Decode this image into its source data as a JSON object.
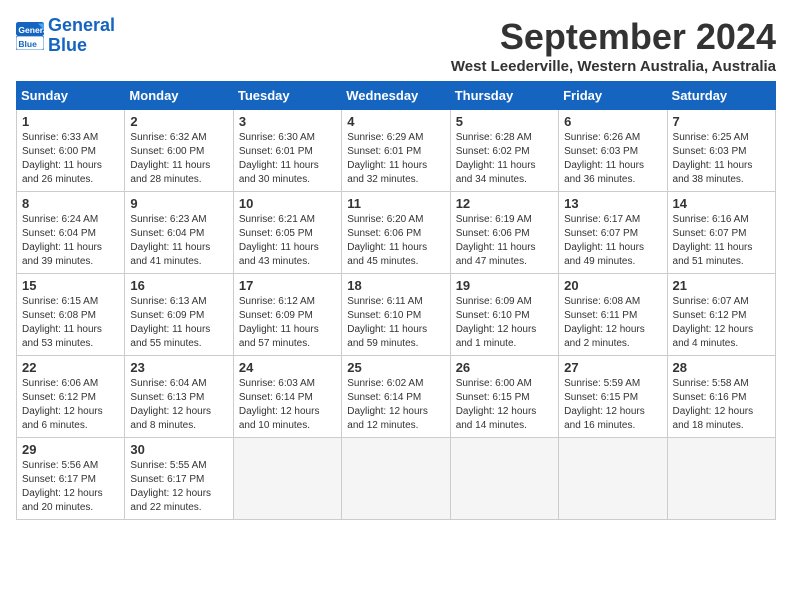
{
  "logo": {
    "line1": "General",
    "line2": "Blue"
  },
  "title": "September 2024",
  "location": "West Leederville, Western Australia, Australia",
  "weekdays": [
    "Sunday",
    "Monday",
    "Tuesday",
    "Wednesday",
    "Thursday",
    "Friday",
    "Saturday"
  ],
  "weeks": [
    [
      {
        "day": "1",
        "lines": [
          "Sunrise: 6:33 AM",
          "Sunset: 6:00 PM",
          "Daylight: 11 hours",
          "and 26 minutes."
        ]
      },
      {
        "day": "2",
        "lines": [
          "Sunrise: 6:32 AM",
          "Sunset: 6:00 PM",
          "Daylight: 11 hours",
          "and 28 minutes."
        ]
      },
      {
        "day": "3",
        "lines": [
          "Sunrise: 6:30 AM",
          "Sunset: 6:01 PM",
          "Daylight: 11 hours",
          "and 30 minutes."
        ]
      },
      {
        "day": "4",
        "lines": [
          "Sunrise: 6:29 AM",
          "Sunset: 6:01 PM",
          "Daylight: 11 hours",
          "and 32 minutes."
        ]
      },
      {
        "day": "5",
        "lines": [
          "Sunrise: 6:28 AM",
          "Sunset: 6:02 PM",
          "Daylight: 11 hours",
          "and 34 minutes."
        ]
      },
      {
        "day": "6",
        "lines": [
          "Sunrise: 6:26 AM",
          "Sunset: 6:03 PM",
          "Daylight: 11 hours",
          "and 36 minutes."
        ]
      },
      {
        "day": "7",
        "lines": [
          "Sunrise: 6:25 AM",
          "Sunset: 6:03 PM",
          "Daylight: 11 hours",
          "and 38 minutes."
        ]
      }
    ],
    [
      {
        "day": "8",
        "lines": [
          "Sunrise: 6:24 AM",
          "Sunset: 6:04 PM",
          "Daylight: 11 hours",
          "and 39 minutes."
        ]
      },
      {
        "day": "9",
        "lines": [
          "Sunrise: 6:23 AM",
          "Sunset: 6:04 PM",
          "Daylight: 11 hours",
          "and 41 minutes."
        ]
      },
      {
        "day": "10",
        "lines": [
          "Sunrise: 6:21 AM",
          "Sunset: 6:05 PM",
          "Daylight: 11 hours",
          "and 43 minutes."
        ]
      },
      {
        "day": "11",
        "lines": [
          "Sunrise: 6:20 AM",
          "Sunset: 6:06 PM",
          "Daylight: 11 hours",
          "and 45 minutes."
        ]
      },
      {
        "day": "12",
        "lines": [
          "Sunrise: 6:19 AM",
          "Sunset: 6:06 PM",
          "Daylight: 11 hours",
          "and 47 minutes."
        ]
      },
      {
        "day": "13",
        "lines": [
          "Sunrise: 6:17 AM",
          "Sunset: 6:07 PM",
          "Daylight: 11 hours",
          "and 49 minutes."
        ]
      },
      {
        "day": "14",
        "lines": [
          "Sunrise: 6:16 AM",
          "Sunset: 6:07 PM",
          "Daylight: 11 hours",
          "and 51 minutes."
        ]
      }
    ],
    [
      {
        "day": "15",
        "lines": [
          "Sunrise: 6:15 AM",
          "Sunset: 6:08 PM",
          "Daylight: 11 hours",
          "and 53 minutes."
        ]
      },
      {
        "day": "16",
        "lines": [
          "Sunrise: 6:13 AM",
          "Sunset: 6:09 PM",
          "Daylight: 11 hours",
          "and 55 minutes."
        ]
      },
      {
        "day": "17",
        "lines": [
          "Sunrise: 6:12 AM",
          "Sunset: 6:09 PM",
          "Daylight: 11 hours",
          "and 57 minutes."
        ]
      },
      {
        "day": "18",
        "lines": [
          "Sunrise: 6:11 AM",
          "Sunset: 6:10 PM",
          "Daylight: 11 hours",
          "and 59 minutes."
        ]
      },
      {
        "day": "19",
        "lines": [
          "Sunrise: 6:09 AM",
          "Sunset: 6:10 PM",
          "Daylight: 12 hours",
          "and 1 minute."
        ]
      },
      {
        "day": "20",
        "lines": [
          "Sunrise: 6:08 AM",
          "Sunset: 6:11 PM",
          "Daylight: 12 hours",
          "and 2 minutes."
        ]
      },
      {
        "day": "21",
        "lines": [
          "Sunrise: 6:07 AM",
          "Sunset: 6:12 PM",
          "Daylight: 12 hours",
          "and 4 minutes."
        ]
      }
    ],
    [
      {
        "day": "22",
        "lines": [
          "Sunrise: 6:06 AM",
          "Sunset: 6:12 PM",
          "Daylight: 12 hours",
          "and 6 minutes."
        ]
      },
      {
        "day": "23",
        "lines": [
          "Sunrise: 6:04 AM",
          "Sunset: 6:13 PM",
          "Daylight: 12 hours",
          "and 8 minutes."
        ]
      },
      {
        "day": "24",
        "lines": [
          "Sunrise: 6:03 AM",
          "Sunset: 6:14 PM",
          "Daylight: 12 hours",
          "and 10 minutes."
        ]
      },
      {
        "day": "25",
        "lines": [
          "Sunrise: 6:02 AM",
          "Sunset: 6:14 PM",
          "Daylight: 12 hours",
          "and 12 minutes."
        ]
      },
      {
        "day": "26",
        "lines": [
          "Sunrise: 6:00 AM",
          "Sunset: 6:15 PM",
          "Daylight: 12 hours",
          "and 14 minutes."
        ]
      },
      {
        "day": "27",
        "lines": [
          "Sunrise: 5:59 AM",
          "Sunset: 6:15 PM",
          "Daylight: 12 hours",
          "and 16 minutes."
        ]
      },
      {
        "day": "28",
        "lines": [
          "Sunrise: 5:58 AM",
          "Sunset: 6:16 PM",
          "Daylight: 12 hours",
          "and 18 minutes."
        ]
      }
    ],
    [
      {
        "day": "29",
        "lines": [
          "Sunrise: 5:56 AM",
          "Sunset: 6:17 PM",
          "Daylight: 12 hours",
          "and 20 minutes."
        ]
      },
      {
        "day": "30",
        "lines": [
          "Sunrise: 5:55 AM",
          "Sunset: 6:17 PM",
          "Daylight: 12 hours",
          "and 22 minutes."
        ]
      },
      null,
      null,
      null,
      null,
      null
    ]
  ]
}
